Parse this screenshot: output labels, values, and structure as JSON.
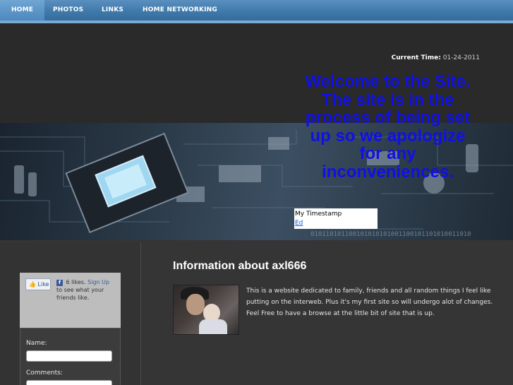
{
  "nav": {
    "items": [
      {
        "label": "HOME"
      },
      {
        "label": "PHOTOS"
      },
      {
        "label": "LINKS"
      },
      {
        "label": "HOME NETWORKING"
      }
    ]
  },
  "header": {
    "time_label": "Current Time:",
    "time_value": "01-24-2011",
    "welcome_text": "Welcome to the Site. The site is in the process of being set up so we apologize for any inconveniences.",
    "stamp_title": "My Timestamp",
    "stamp_link": "Ed"
  },
  "sidebar": {
    "like_label": "Like",
    "likes_text": "6 likes.",
    "signup_link": "Sign Up",
    "likes_suffix": "to see what your friends like.",
    "name_label": "Name:",
    "comments_label": "Comments:"
  },
  "main": {
    "title": "Information about axl666",
    "description_lines": [
      "This is a website dedicated to family, friends and all random things I feel like putting on the interweb. Plus it's my first site so will undergo alot of changes.",
      "Feel Free to have a browse at the little bit of site that is up."
    ]
  },
  "colors": {
    "nav_bar": "#3f7aab",
    "welcome_text": "#1010e6",
    "background": "#2b2b2b"
  }
}
